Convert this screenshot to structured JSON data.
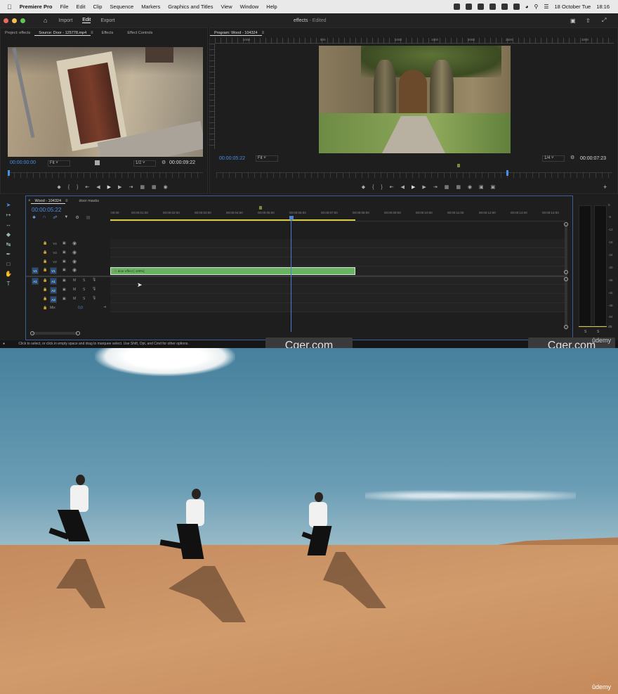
{
  "menubar": {
    "app_name": "Premiere Pro",
    "items": [
      "File",
      "Edit",
      "Clip",
      "Sequence",
      "Markers",
      "Graphics and Titles",
      "View",
      "Window",
      "Help"
    ],
    "date": "18 October Tue",
    "time": "18:16"
  },
  "header": {
    "tabs": [
      "Import",
      "Edit",
      "Export"
    ],
    "active_tab": "Edit",
    "project_title": "effects",
    "status": "- Edited"
  },
  "source_panel": {
    "tabs": [
      "Project: effects",
      "Source: Door - 125778.mp4",
      "Effects",
      "Effect Controls"
    ],
    "timecode": "00:00:00:00",
    "fit": "Fit",
    "resolution": "1/2",
    "duration": "00:00:09:22"
  },
  "program_panel": {
    "title": "Program: Wood - 104324",
    "timecode": "00:00:05:22",
    "fit": "Fit",
    "resolution": "1/4",
    "duration": "00:00:07:23",
    "ruler": [
      "1000",
      "500",
      "1000",
      "1500",
      "2000",
      "2500",
      "3000"
    ]
  },
  "timeline": {
    "tabs": [
      "Wood - 104324",
      "door masks"
    ],
    "timecode": "00:00:05:22",
    "ruler": [
      ":00:00",
      "00:00:01:00",
      "00:00:02:00",
      "00:00:03:00",
      "00:00:04:00",
      "00:00:05:00",
      "00:00:06:00",
      "00:00:07:00",
      "00:00:08:00",
      "00:00:09:00",
      "00:00:10:00",
      "00:00:11:00",
      "00:00:12:00",
      "00:00:13:00",
      "00:00:14:00"
    ],
    "video_tracks": [
      "V4",
      "V3",
      "V2",
      "V1"
    ],
    "audio_tracks": [
      "A1",
      "A2",
      "A3"
    ],
    "source_patch": [
      "V1",
      "A1"
    ],
    "mix_label": "Mix",
    "mix_value": "0,0",
    "clip_label": "door effect [ 100%]",
    "playhead_fraction": 0.406
  },
  "meter": {
    "scale": [
      "0",
      "-6",
      "-12",
      "-18",
      "-24",
      "-30",
      "-36",
      "-42",
      "-48",
      "-54",
      "dB"
    ],
    "labels": [
      "S",
      "S"
    ]
  },
  "status_bar": "Click to select, or click in empty space and drag to marquee select. Use Shift, Opt, and Cmd for other options.",
  "watermarks": [
    "Cger.com",
    "Cger.com"
  ],
  "brand": "ûdemy",
  "brand2": "ûdemy",
  "colors": {
    "accent": "#4a8fe7",
    "clip_green": "#68b360",
    "playhead": "#4a7fd4",
    "sky": "#6a9db5",
    "sand": "#c48b5e"
  }
}
